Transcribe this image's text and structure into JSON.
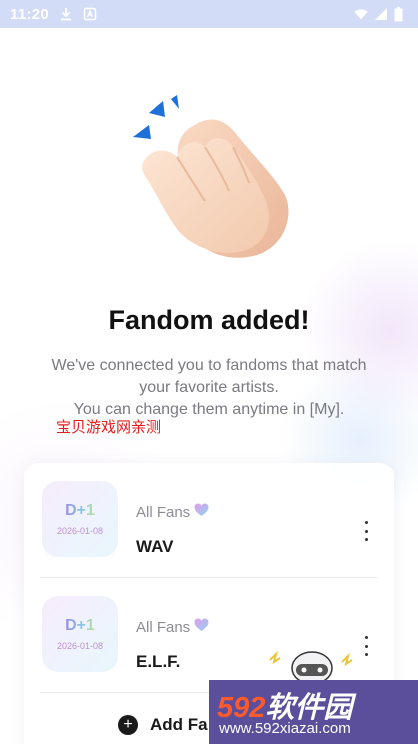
{
  "status_bar": {
    "time": "11:20",
    "icons": [
      "download-icon",
      "app-notification-icon",
      "wifi-icon",
      "signal-icon",
      "battery-icon"
    ]
  },
  "hero": {
    "icon": "clapping-hands-icon"
  },
  "title": "Fandom added!",
  "subtitle": {
    "line1": "We've connected you to fandoms that match",
    "line2": "your favorite artists.",
    "line3": "You can change them anytime in [My]."
  },
  "watermark_text": "宝贝游戏网亲测",
  "fandoms": [
    {
      "dday": "D+1",
      "date": "2026-01-08",
      "tag": "All Fans",
      "name": "WAV"
    },
    {
      "dday": "D+1",
      "date": "2026-01-08",
      "tag": "All Fans",
      "name": "E.L.F."
    }
  ],
  "add_button": {
    "label": "Add Fa"
  },
  "site_overlay": {
    "brand_num": "592",
    "brand_cn": "软件园",
    "url": "www.592xiazai.com"
  },
  "colors": {
    "accent_heart": "#b48ef0",
    "status_bar": "#d3dcf6",
    "overlay": "#5b4e9a",
    "brand_orange": "#ff5a2b"
  }
}
